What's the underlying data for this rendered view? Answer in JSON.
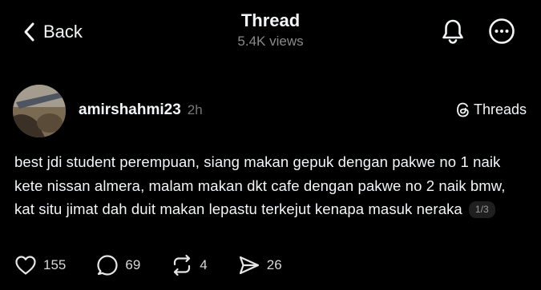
{
  "header": {
    "back_label": "Back",
    "title": "Thread",
    "views": "5.4K views"
  },
  "post": {
    "username": "amirshahmi23",
    "time": "2h",
    "brand_label": "Threads",
    "text": "best jdi student perempuan, siang makan gepuk dengan pakwe no 1 naik kete nissan almera, malam makan dkt cafe dengan pakwe no 2 naik bmw, kat situ jimat dah duit makan lepastu terkejut kenapa masuk neraka",
    "pager": "1/3",
    "likes": "155",
    "replies": "69",
    "reposts": "4",
    "shares": "26"
  },
  "icons": {
    "back": "chevron-left-icon",
    "notifications": "bell-icon",
    "more": "more-horizontal-icon",
    "brand": "threads-logo-icon",
    "like": "heart-icon",
    "reply": "comment-icon",
    "repost": "repost-icon",
    "share": "send-icon"
  },
  "colors": {
    "background": "#000000",
    "text": "#f3f5f7",
    "muted": "#8a8a8a"
  }
}
